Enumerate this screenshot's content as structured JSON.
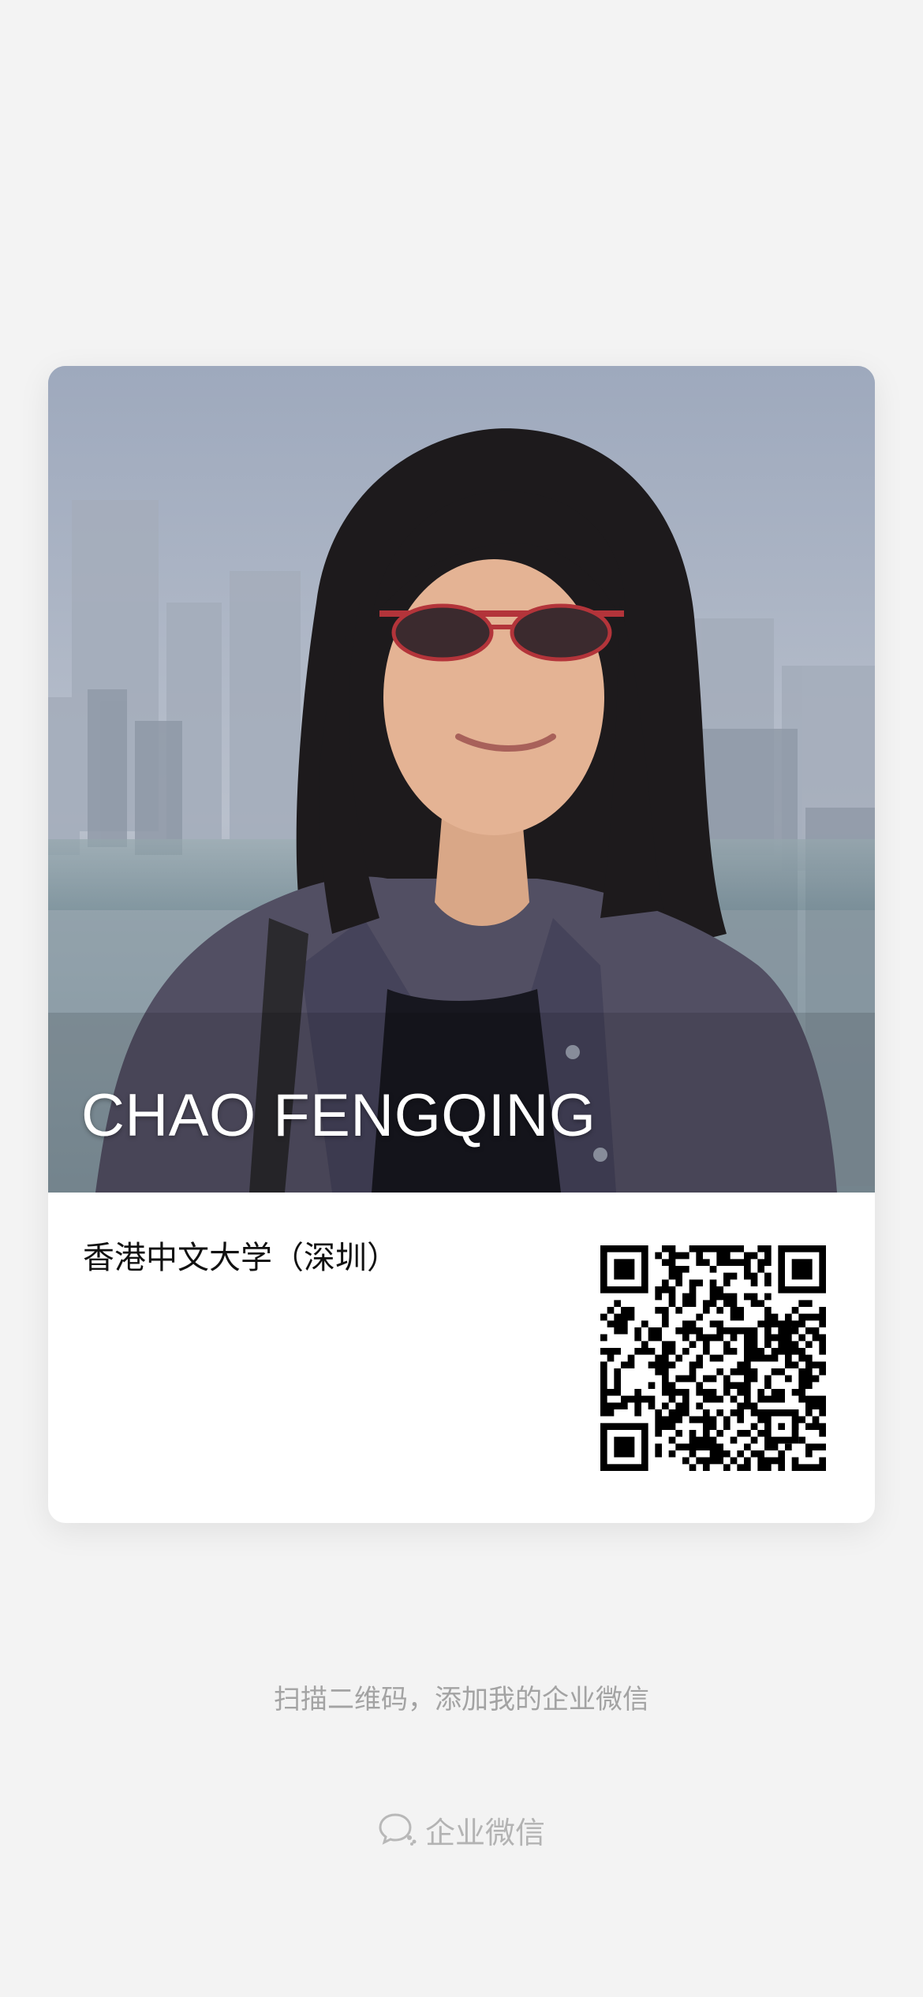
{
  "card": {
    "name": "CHAO FENGQING",
    "organization": "香港中文大学（深圳）",
    "photo": "profile-photo",
    "qr_code": "qr-code-icon"
  },
  "footer": {
    "hint": "扫描二维码，添加我的企业微信",
    "brand_icon": "wecom-chat-icon",
    "brand_label": "企业微信"
  },
  "colors": {
    "background": "#f3f3f3",
    "card": "#ffffff",
    "hint_text": "#a3a3a3",
    "brand_text": "#b3b3b3"
  }
}
